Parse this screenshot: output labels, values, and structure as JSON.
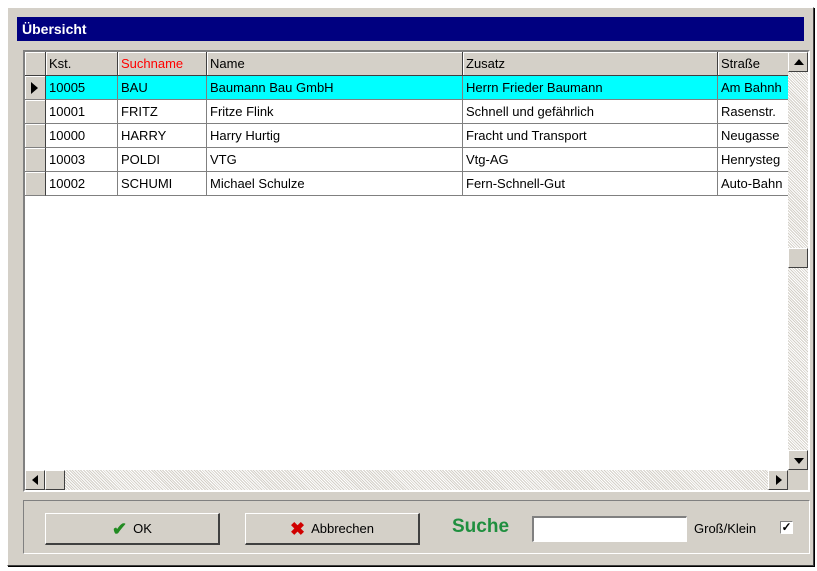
{
  "window": {
    "title": "Übersicht"
  },
  "table": {
    "columns": [
      "Kst.",
      "Suchname",
      "Name",
      "Zusatz",
      "Straße"
    ],
    "sort_column_color": "#ff0000",
    "selected_row_color": "#00ffff",
    "rows": [
      {
        "kst": "10005",
        "suchname": "BAU",
        "name": "Baumann Bau GmbH",
        "zusatz": "Herrn Frieder Baumann",
        "strasse": "Am Bahnh"
      },
      {
        "kst": "10001",
        "suchname": "FRITZ",
        "name": "Fritze Flink",
        "zusatz": "Schnell und gefährlich",
        "strasse": "Rasenstr."
      },
      {
        "kst": "10000",
        "suchname": "HARRY",
        "name": "Harry Hurtig",
        "zusatz": "Fracht und Transport",
        "strasse": "Neugasse"
      },
      {
        "kst": "10003",
        "suchname": "POLDI",
        "name": "VTG",
        "zusatz": "Vtg-AG",
        "strasse": "Henrysteg"
      },
      {
        "kst": "10002",
        "suchname": "SCHUMI",
        "name": "Michael Schulze",
        "zusatz": "Fern-Schnell-Gut",
        "strasse": "Auto-Bahn"
      }
    ]
  },
  "buttons": {
    "ok": "OK",
    "cancel": "Abbrechen"
  },
  "search": {
    "label": "Suche",
    "value": ""
  },
  "case_toggle": {
    "label": "Groß/Klein",
    "checked": "✓"
  },
  "icons": {
    "ok": "checkmark-icon",
    "cancel": "x-icon",
    "row_indicator": "triangle-right-icon"
  }
}
